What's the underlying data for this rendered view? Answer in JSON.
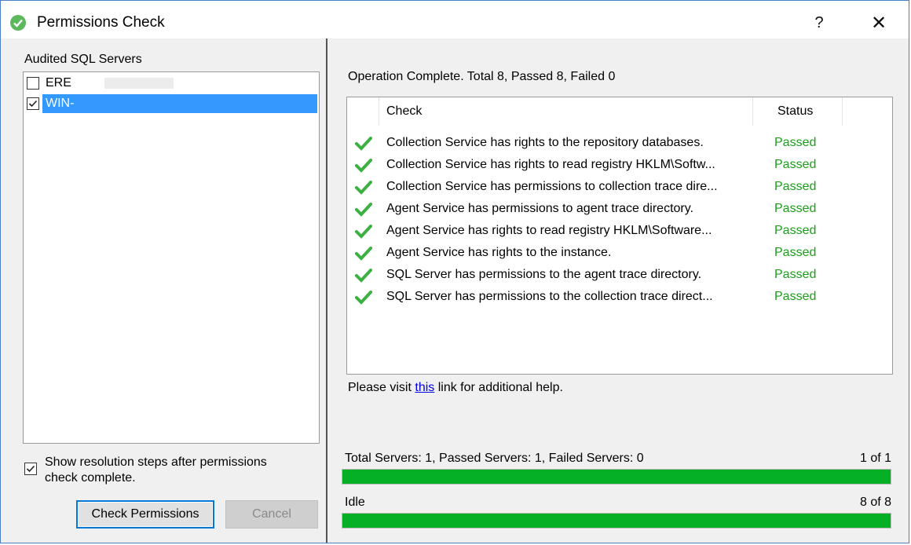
{
  "window": {
    "title": "Permissions Check",
    "help_label": "?",
    "close_label": "✕"
  },
  "left": {
    "servers_label": "Audited SQL Servers",
    "servers": [
      {
        "name": "ERE",
        "checked": false,
        "selected": false
      },
      {
        "name": "WIN-",
        "checked": true,
        "selected": true
      }
    ],
    "show_resolution_label": "Show resolution steps after permissions check complete.",
    "show_resolution_checked": true,
    "check_button": "Check Permissions",
    "cancel_button": "Cancel"
  },
  "right": {
    "operation_status": "Operation Complete. Total 8, Passed 8, Failed 0",
    "columns": {
      "check": "Check",
      "status": "Status"
    },
    "rows": [
      {
        "check": "Collection Service has rights to the repository databases.",
        "status": "Passed"
      },
      {
        "check": "Collection Service has rights to read registry HKLM\\Softw...",
        "status": "Passed"
      },
      {
        "check": "Collection Service has permissions to collection trace dire...",
        "status": "Passed"
      },
      {
        "check": "Agent Service has permissions to agent trace directory.",
        "status": "Passed"
      },
      {
        "check": "Agent Service has rights to read registry HKLM\\Software...",
        "status": "Passed"
      },
      {
        "check": "Agent Service has rights to the instance.",
        "status": "Passed"
      },
      {
        "check": "SQL Server has permissions to the agent trace directory.",
        "status": "Passed"
      },
      {
        "check": "SQL Server has permissions to the collection trace direct...",
        "status": "Passed"
      }
    ],
    "help_prefix": "Please visit ",
    "help_link": "this",
    "help_suffix": " link for additional help.",
    "servers_progress": {
      "label": "Total Servers: 1, Passed Servers: 1, Failed Servers: 0",
      "count": "1 of 1",
      "fraction": 1.0
    },
    "checks_progress": {
      "label": "Idle",
      "count": "8 of 8",
      "fraction": 1.0
    }
  },
  "colors": {
    "passed": "#1aa01a",
    "progress": "#06b025",
    "selection": "#3399ff",
    "check_icon": "#3cb043"
  }
}
